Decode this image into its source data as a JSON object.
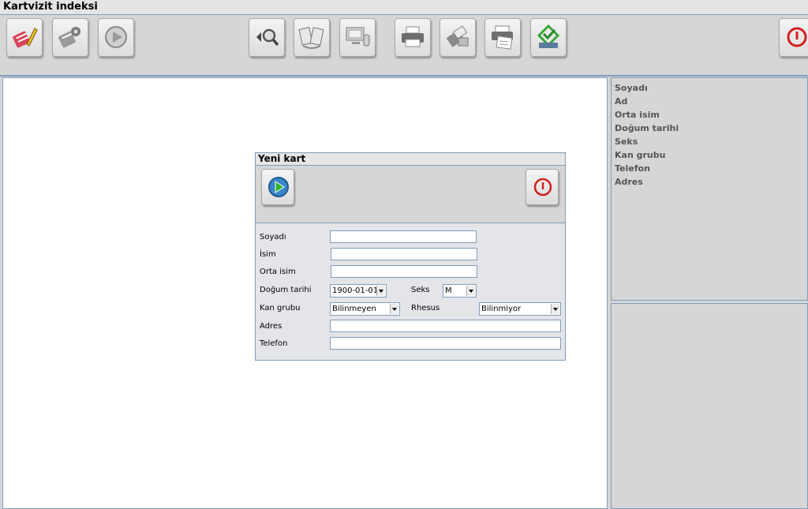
{
  "window": {
    "title": "Kartvizit indeksi"
  },
  "toolbar": {
    "buttons": [
      {
        "icon": "edit-icon"
      },
      {
        "icon": "database-settings-icon"
      },
      {
        "icon": "play-icon"
      },
      {
        "icon": "search-icon"
      },
      {
        "icon": "copy-cards-icon"
      },
      {
        "icon": "computer-icon"
      },
      {
        "icon": "printer-icon"
      },
      {
        "icon": "print-settings-icon"
      },
      {
        "icon": "print-preview-icon"
      },
      {
        "icon": "recycle-print-icon"
      },
      {
        "icon": "power-icon"
      }
    ]
  },
  "right_panel": {
    "fields": [
      "Soyadı",
      "Ad",
      "Orta isim",
      "Doğum tarihi",
      "Seks",
      "Kan grubu",
      "Telefon",
      "Adres"
    ]
  },
  "dialog": {
    "title": "Yeni kart",
    "form": {
      "surname_label": "Soyadı",
      "surname_value": "",
      "name_label": "İsim",
      "name_value": "",
      "middle_label": "Orta isim",
      "middle_value": "",
      "birth_label": "Doğum tarihi",
      "birth_value": "1900-01-01",
      "sex_label": "Seks",
      "sex_value": "M",
      "blood_label": "Kan grubu",
      "blood_value": "Bilinmeyen",
      "rhesus_label": "Rhesus",
      "rhesus_value": "Bilinmiyor",
      "address_label": "Adres",
      "address_value": "",
      "phone_label": "Telefon",
      "phone_value": ""
    }
  },
  "colors": {
    "accent_border": "#7f9db9",
    "power_red": "#d32020",
    "play_green": "#2fb52f"
  }
}
